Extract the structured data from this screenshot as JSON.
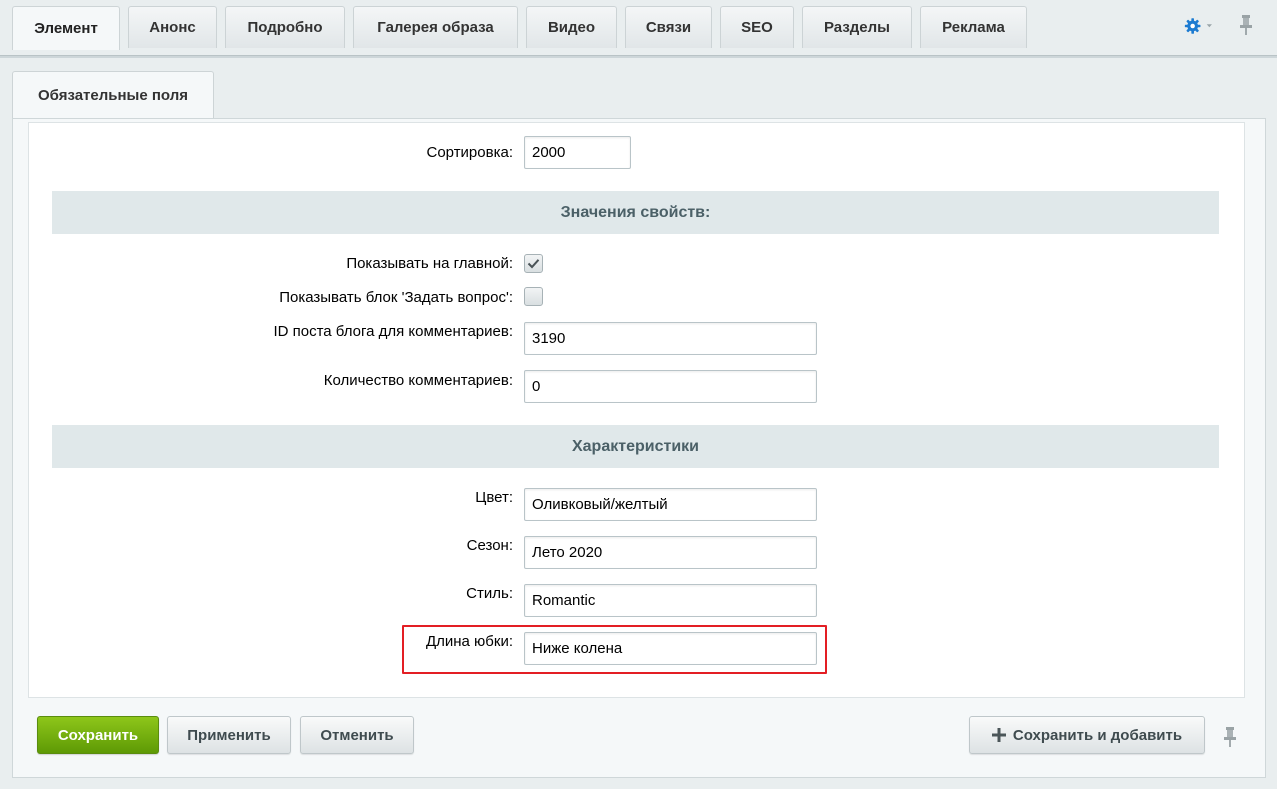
{
  "tabs": [
    {
      "label": "Элемент"
    },
    {
      "label": "Анонс"
    },
    {
      "label": "Подробно"
    },
    {
      "label": "Галерея образа"
    },
    {
      "label": "Видео"
    },
    {
      "label": "Связи"
    },
    {
      "label": "SEO"
    },
    {
      "label": "Разделы"
    },
    {
      "label": "Реклама"
    }
  ],
  "active_tab": "Элемент",
  "toolbar": {
    "settings_icon": "gear-icon",
    "pin_icon": "pin-icon",
    "accent_color": "#1c7bd1"
  },
  "subtab": {
    "label": "Обязательные поля"
  },
  "form": {
    "sort": {
      "label": "Сортировка:",
      "value": "2000"
    },
    "properties_header": "Значения свойств:",
    "show_on_main": {
      "label": "Показывать на главной:",
      "checked": true
    },
    "show_question_block": {
      "label": "Показывать блок 'Задать вопрос':",
      "checked": false
    },
    "blog_post_id": {
      "label": "ID поста блога для комментариев:",
      "value": "3190"
    },
    "comments_count": {
      "label": "Количество комментариев:",
      "value": "0"
    },
    "characteristics_header": "Характеристики",
    "color": {
      "label": "Цвет:",
      "value": "Оливковый/желтый"
    },
    "season": {
      "label": "Сезон:",
      "value": "Лето 2020"
    },
    "style": {
      "label": "Стиль:",
      "value": "Romantic"
    },
    "skirt_length": {
      "label": "Длина юбки:",
      "value": "Ниже колена"
    }
  },
  "highlight_color": "#e31e24",
  "buttons": {
    "save": "Сохранить",
    "apply": "Применить",
    "cancel": "Отменить",
    "save_add": "Сохранить и добавить",
    "save_color": "#6fab0c"
  }
}
